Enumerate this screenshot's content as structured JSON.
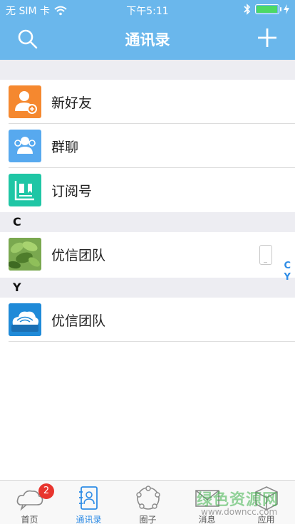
{
  "status_bar": {
    "carrier": "无 SIM 卡",
    "time": "下午5:11",
    "wifi_icon": "wifi-icon",
    "bluetooth_icon": "bluetooth-icon",
    "charging_icon": "charging-icon"
  },
  "nav": {
    "title": "通讯录",
    "search_icon": "search-icon",
    "add_icon": "plus-icon"
  },
  "shortcuts": [
    {
      "label": "新好友",
      "icon": "new-friend-icon",
      "color": "#f5882f"
    },
    {
      "label": "群聊",
      "icon": "group-chat-icon",
      "color": "#57a9ef"
    },
    {
      "label": "订阅号",
      "icon": "subscription-icon",
      "color": "#1fc6a5"
    }
  ],
  "sections": [
    {
      "letter": "C",
      "contacts": [
        {
          "name": "优信团队",
          "device_icon": "mobile-phone-icon"
        }
      ]
    },
    {
      "letter": "Y",
      "contacts": [
        {
          "name": "优信团队"
        }
      ]
    }
  ],
  "index_letters": [
    "C",
    "Y"
  ],
  "tabs": [
    {
      "label": "首页",
      "icon": "cloud-chat-icon",
      "badge": "2"
    },
    {
      "label": "通讯录",
      "icon": "contacts-book-icon",
      "active": true
    },
    {
      "label": "圈子",
      "icon": "circle-icon"
    },
    {
      "label": "消息",
      "icon": "envelope-icon"
    },
    {
      "label": "应用",
      "icon": "app-box-icon"
    }
  ],
  "watermark": {
    "main": "绿色资源网",
    "sub": "www.downcc.com"
  },
  "colors": {
    "header": "#6ab7ec",
    "accent": "#2e8ce6",
    "badge": "#e8352e",
    "section_bg": "#ededf2"
  }
}
